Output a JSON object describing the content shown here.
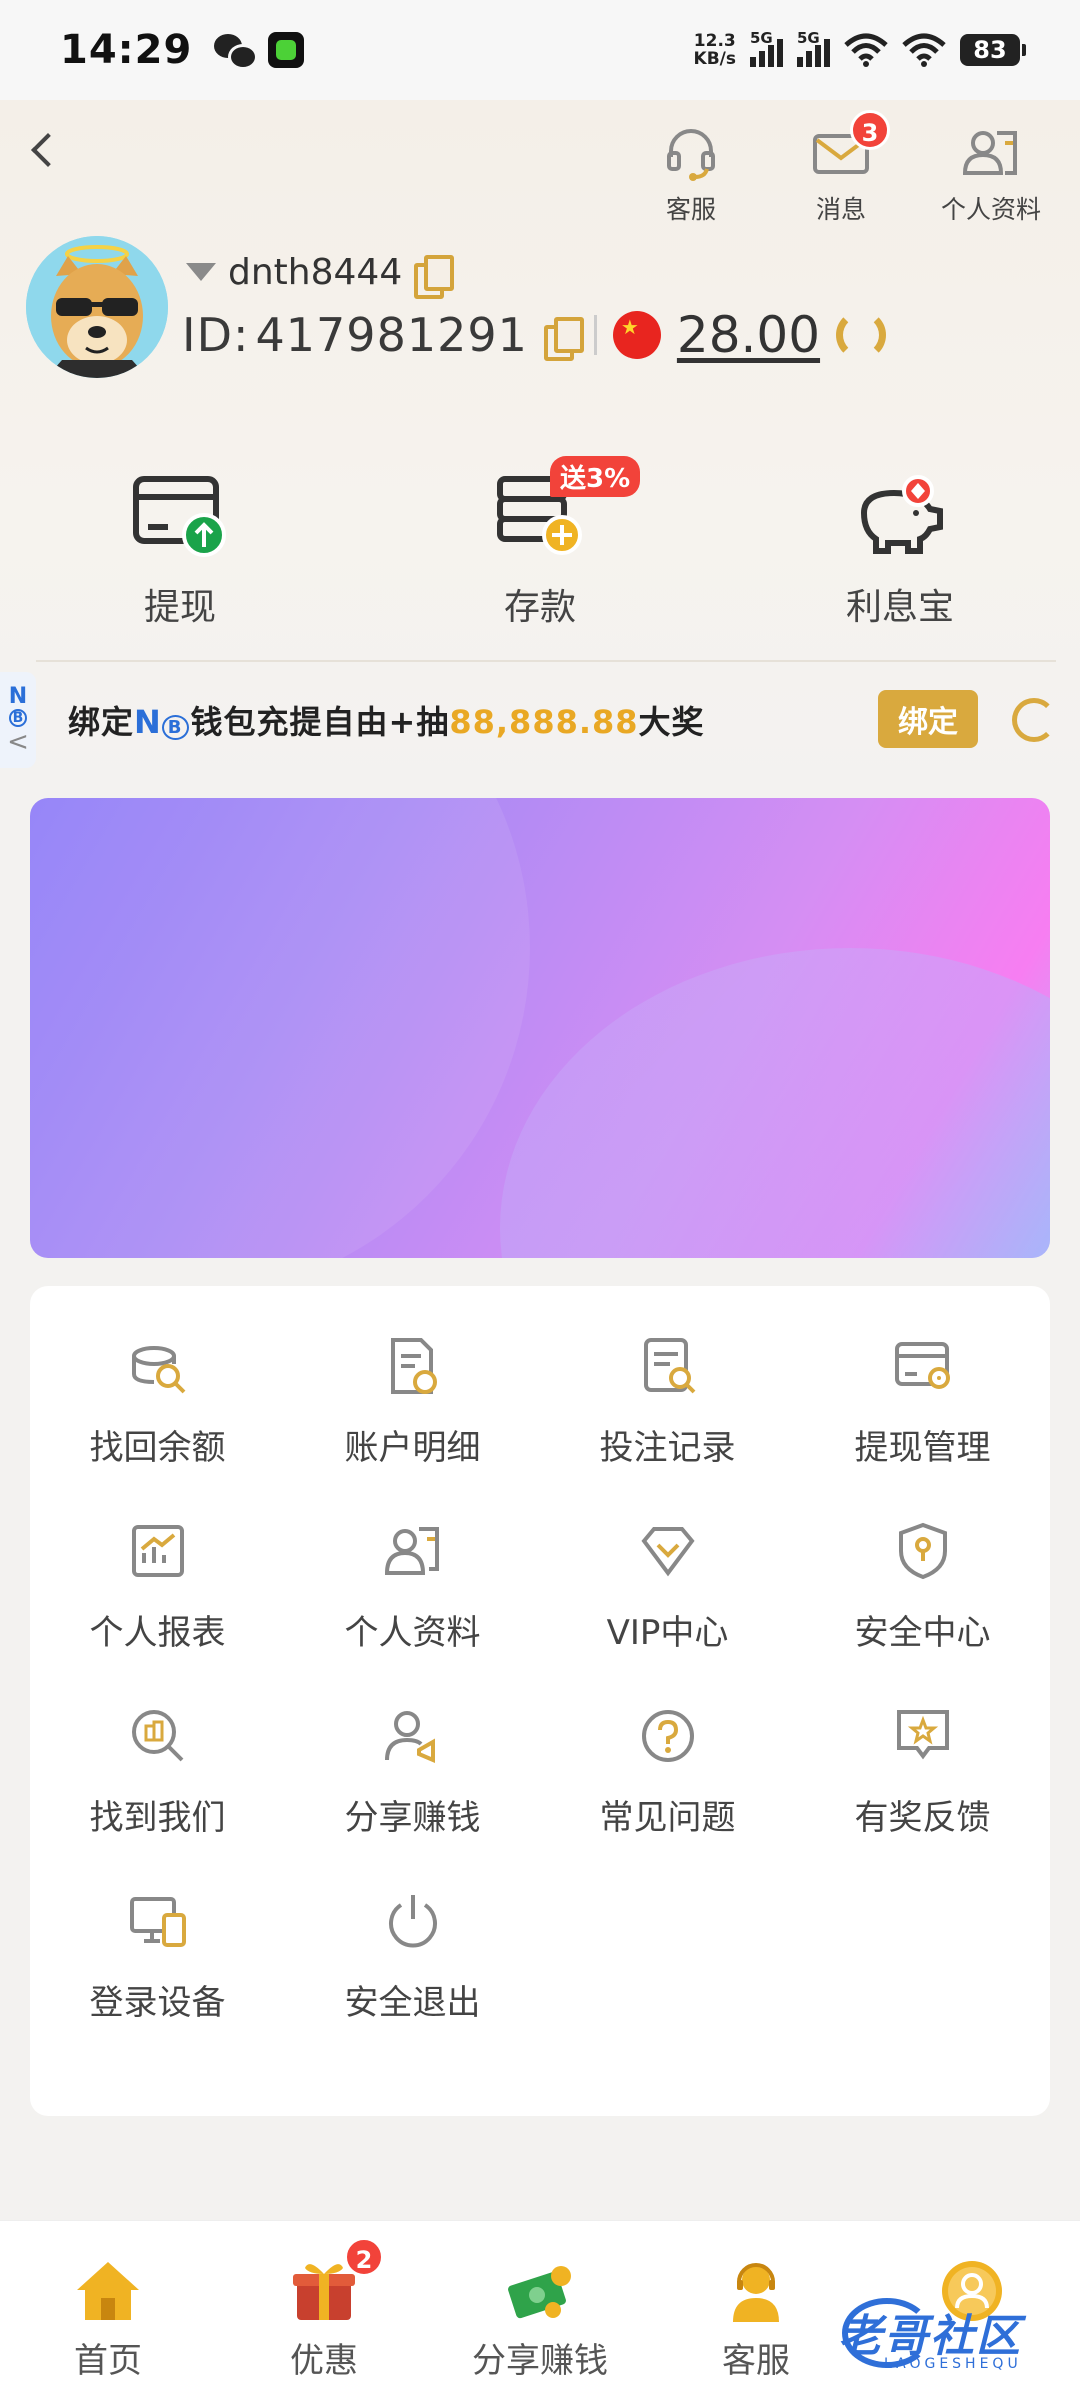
{
  "status_bar": {
    "time": "14:29",
    "net_speed_value": "12.3",
    "net_speed_unit": "KB/s",
    "sim1": "5G",
    "sim2": "5G",
    "battery": "83"
  },
  "header": {
    "actions": [
      {
        "label": "客服",
        "icon": "headset-icon"
      },
      {
        "label": "消息",
        "icon": "mail-icon",
        "badge": "3"
      },
      {
        "label": "个人资料",
        "icon": "profile-card-icon"
      }
    ],
    "username": "dnth8444",
    "id_label": "ID:",
    "id_value": "417981291",
    "balance": "28.00",
    "colors": {
      "gold": "#d9a93e",
      "red": "#f2433a",
      "green": "#1aa34a"
    }
  },
  "quick_actions": [
    {
      "label": "提现",
      "icon": "withdraw-card-icon"
    },
    {
      "label": "存款",
      "icon": "deposit-icon",
      "tag": "送3%"
    },
    {
      "label": "利息宝",
      "icon": "piggy-bank-icon"
    }
  ],
  "side_tab": {
    "letter": "N",
    "sub": "B",
    "chevron": "<"
  },
  "bind_bar": {
    "text_before": "绑定",
    "brand": "N",
    "brand_sub": "B",
    "text_middle": "钱包充提自由+抽",
    "amount": "88,888.88",
    "text_after": "大奖",
    "button": "绑定"
  },
  "menu": [
    {
      "label": "找回余额",
      "icon": "coin-search-icon"
    },
    {
      "label": "账户明细",
      "icon": "account-detail-icon"
    },
    {
      "label": "投注记录",
      "icon": "bet-record-icon"
    },
    {
      "label": "提现管理",
      "icon": "withdraw-manage-icon"
    },
    {
      "label": "个人报表",
      "icon": "report-chart-icon"
    },
    {
      "label": "个人资料",
      "icon": "profile-icon"
    },
    {
      "label": "VIP中心",
      "icon": "vip-diamond-icon"
    },
    {
      "label": "安全中心",
      "icon": "shield-icon"
    },
    {
      "label": "找到我们",
      "icon": "find-us-icon"
    },
    {
      "label": "分享赚钱",
      "icon": "share-earn-icon"
    },
    {
      "label": "常见问题",
      "icon": "question-icon"
    },
    {
      "label": "有奖反馈",
      "icon": "feedback-star-icon"
    },
    {
      "label": "登录设备",
      "icon": "devices-icon"
    },
    {
      "label": "安全退出",
      "icon": "power-icon"
    }
  ],
  "bottom_nav": [
    {
      "label": "首页",
      "icon": "home-icon"
    },
    {
      "label": "优惠",
      "icon": "gift-icon",
      "badge": "2"
    },
    {
      "label": "分享赚钱",
      "icon": "money-icon"
    },
    {
      "label": "客服",
      "icon": "support-agent-icon"
    },
    {
      "label": "",
      "icon": "my-avatar-icon"
    }
  ],
  "watermark": {
    "text": "老哥社区",
    "sub": "LAOGESHEQU"
  }
}
